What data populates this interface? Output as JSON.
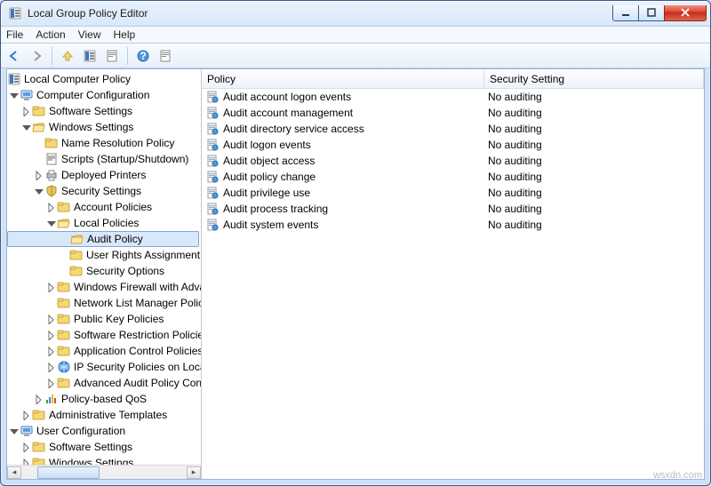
{
  "window": {
    "title": "Local Group Policy Editor"
  },
  "menus": [
    "File",
    "Action",
    "View",
    "Help"
  ],
  "tree": {
    "root": "Local Computer Policy",
    "computer_cfg": "Computer Configuration",
    "cc_software": "Software Settings",
    "cc_windows": "Windows Settings",
    "nrp": "Name Resolution Policy",
    "scripts": "Scripts (Startup/Shutdown)",
    "deployed": "Deployed Printers",
    "security": "Security Settings",
    "acct": "Account Policies",
    "local": "Local Policies",
    "audit": "Audit Policy",
    "ura": "User Rights Assignment",
    "secopt": "Security Options",
    "wfw": "Windows Firewall with Advanced Security",
    "nlm": "Network List Manager Policies",
    "pkp": "Public Key Policies",
    "srp": "Software Restriction Policies",
    "acp": "Application Control Policies",
    "ipsec": "IP Security Policies on Local Computer",
    "aap": "Advanced Audit Policy Configuration",
    "qos": "Policy-based QoS",
    "cc_admin": "Administrative Templates",
    "user_cfg": "User Configuration",
    "uc_software": "Software Settings",
    "uc_windows": "Windows Settings"
  },
  "list": {
    "col1": "Policy",
    "col2": "Security Setting",
    "rows": [
      {
        "name": "Audit account logon events",
        "setting": "No auditing"
      },
      {
        "name": "Audit account management",
        "setting": "No auditing"
      },
      {
        "name": "Audit directory service access",
        "setting": "No auditing"
      },
      {
        "name": "Audit logon events",
        "setting": "No auditing"
      },
      {
        "name": "Audit object access",
        "setting": "No auditing"
      },
      {
        "name": "Audit policy change",
        "setting": "No auditing"
      },
      {
        "name": "Audit privilege use",
        "setting": "No auditing"
      },
      {
        "name": "Audit process tracking",
        "setting": "No auditing"
      },
      {
        "name": "Audit system events",
        "setting": "No auditing"
      }
    ]
  },
  "watermark": "wsxdn.com"
}
